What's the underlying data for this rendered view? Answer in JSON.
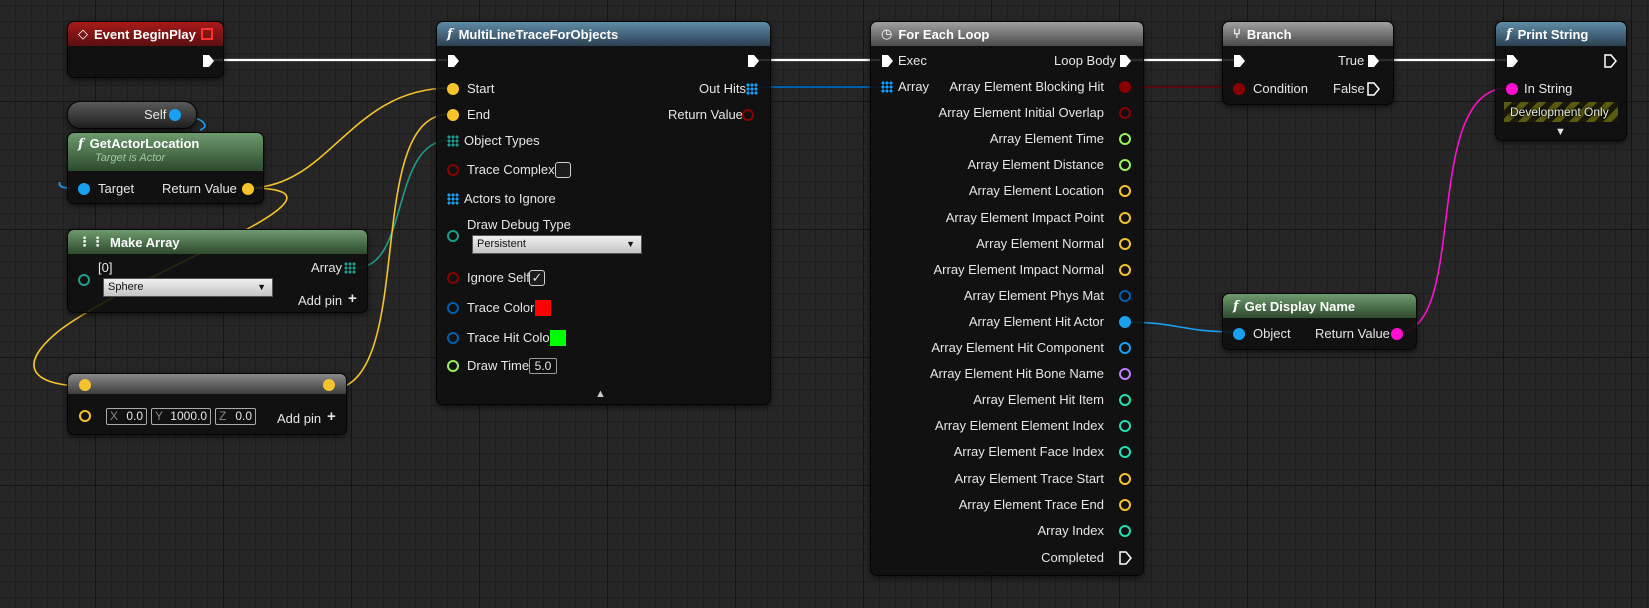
{
  "colors": {
    "exec": "#ffffff",
    "vector": "#f5c42c",
    "bool": "#8a0000",
    "object": "#1aa0f0",
    "array": "#10a0ff",
    "string": "#ff10d0",
    "float": "#9cf25c",
    "int": "#1ee0b0",
    "struct": "#005faa",
    "name": "#c080ff",
    "teal": "#1e9c8c"
  },
  "begin_play": {
    "title": "Event BeginPlay"
  },
  "self_node": {
    "label": "Self"
  },
  "get_actor_location": {
    "title": "GetActorLocation",
    "subtitle": "Target is Actor",
    "target": "Target",
    "return_value": "Return Value"
  },
  "make_array": {
    "title": "Make Array",
    "index0": "[0]",
    "option": "Sphere",
    "array": "Array",
    "add_pin": "Add pin"
  },
  "vector_node": {
    "x_label": "X",
    "x": "0.0",
    "y_label": "Y",
    "y": "1000.0",
    "z_label": "Z",
    "z": "0.0",
    "add_pin": "Add pin"
  },
  "trace": {
    "title": "MultiLineTraceForObjects",
    "start": "Start",
    "end": "End",
    "object_types": "Object Types",
    "trace_complex": "Trace Complex",
    "actors_to_ignore": "Actors to Ignore",
    "draw_debug_type": "Draw Debug Type",
    "debug_option": "Persistent",
    "ignore_self": "Ignore Self",
    "trace_color": "Trace Color",
    "trace_hit_color": "Trace Hit Color",
    "draw_time": "Draw Time",
    "draw_time_value": "5.0",
    "out_hits": "Out Hits",
    "return_value": "Return Value",
    "trace_color_hex": "#ff0000",
    "trace_hit_color_hex": "#00ff00"
  },
  "loop": {
    "title": "For Each Loop",
    "exec": "Exec",
    "array": "Array",
    "loop_body": "Loop Body",
    "completed": "Completed",
    "outputs": [
      "Array Element Blocking Hit",
      "Array Element Initial Overlap",
      "Array Element Time",
      "Array Element Distance",
      "Array Element Location",
      "Array Element Impact Point",
      "Array Element Normal",
      "Array Element Impact Normal",
      "Array Element Phys Mat",
      "Array Element Hit Actor",
      "Array Element Hit Component",
      "Array Element Hit Bone Name",
      "Array Element Hit Item",
      "Array Element Element Index",
      "Array Element Face Index",
      "Array Element Trace Start",
      "Array Element Trace End",
      "Array Index"
    ]
  },
  "branch": {
    "title": "Branch",
    "condition": "Condition",
    "true_label": "True",
    "false_label": "False"
  },
  "display_name": {
    "title": "Get Display Name",
    "object": "Object",
    "return_value": "Return Value"
  },
  "print": {
    "title": "Print String",
    "in_string": "In String",
    "dev_only": "Development Only"
  }
}
